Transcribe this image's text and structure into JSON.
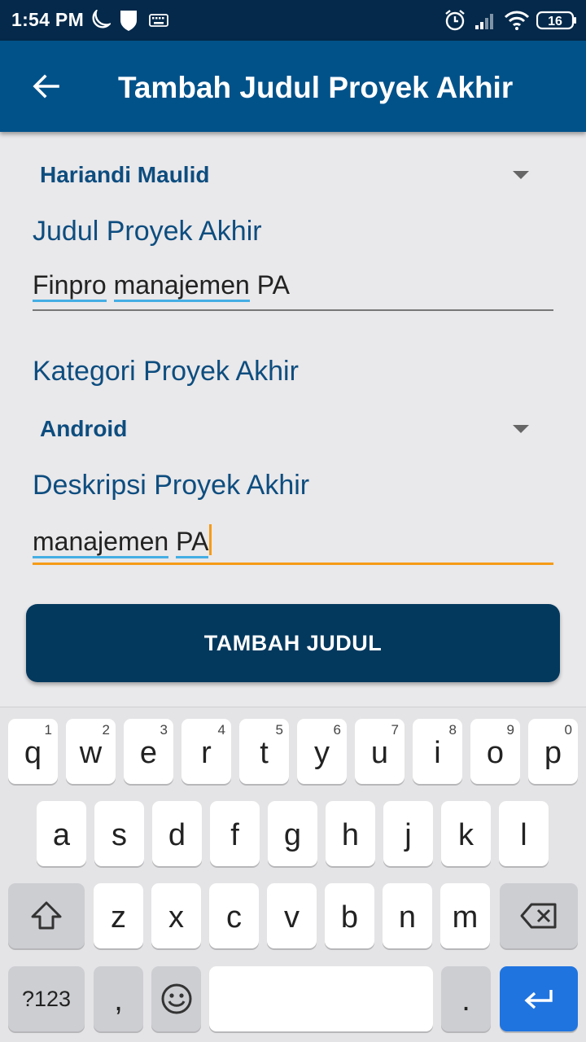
{
  "status_bar": {
    "time": "1:54 PM",
    "battery": "16",
    "icons": [
      "moon-icon",
      "shield-icon",
      "keyboard-icon",
      "alarm-icon",
      "signal-icon",
      "wifi-icon",
      "battery-icon"
    ]
  },
  "app_bar": {
    "title": "Tambah Judul Proyek Akhir",
    "back_icon": "arrow-back-icon"
  },
  "form": {
    "user_spinner_value": "Hariandi Maulid",
    "title_label": "Judul Proyek Akhir",
    "title_value_words": [
      "Finpro",
      "manajemen",
      "PA"
    ],
    "category_label": "Kategori Proyek Akhir",
    "category_spinner_value": "Android",
    "description_label": "Deskripsi Proyek Akhir",
    "description_value_words": [
      "manajemen",
      "PA"
    ],
    "submit_label": "TAMBAH JUDUL"
  },
  "keyboard": {
    "row1": [
      {
        "key": "q",
        "hint": "1"
      },
      {
        "key": "w",
        "hint": "2"
      },
      {
        "key": "e",
        "hint": "3"
      },
      {
        "key": "r",
        "hint": "4"
      },
      {
        "key": "t",
        "hint": "5"
      },
      {
        "key": "y",
        "hint": "6"
      },
      {
        "key": "u",
        "hint": "7"
      },
      {
        "key": "i",
        "hint": "8"
      },
      {
        "key": "o",
        "hint": "9"
      },
      {
        "key": "p",
        "hint": "0"
      }
    ],
    "row2": [
      "a",
      "s",
      "d",
      "f",
      "g",
      "h",
      "j",
      "k",
      "l"
    ],
    "row3": [
      "z",
      "x",
      "c",
      "v",
      "b",
      "n",
      "m"
    ],
    "symbols_label": "?123",
    "comma_label": ",",
    "period_label": ".",
    "shift_icon": "shift-icon",
    "backspace_icon": "backspace-icon",
    "emoji_icon": "emoji-icon",
    "enter_icon": "enter-icon"
  },
  "colors": {
    "status_bar": "#04294a",
    "app_bar": "#02528a",
    "accent_label": "#0d4d7f",
    "button": "#04395e",
    "focus_underline": "#f59b16",
    "spell_underline": "#44aee4",
    "enter_key": "#1f74e0"
  }
}
